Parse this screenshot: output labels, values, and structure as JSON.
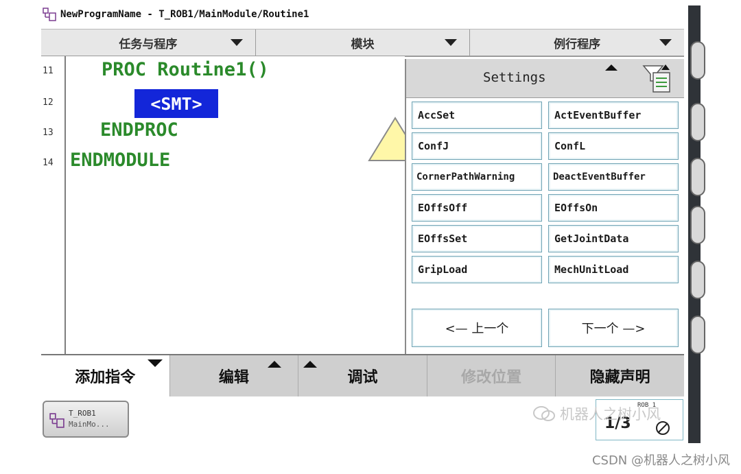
{
  "window": {
    "title": "NewProgramName - T_ROB1/MainModule/Routine1"
  },
  "top_tabs": [
    {
      "label": "任务与程序"
    },
    {
      "label": "模块"
    },
    {
      "label": "例行程序"
    }
  ],
  "editor": {
    "line_numbers": [
      "11",
      "12",
      "13",
      "14"
    ],
    "lines": [
      {
        "text": "PROC Routine1()"
      },
      {
        "text": "<SMT>"
      },
      {
        "text": "ENDPROC"
      },
      {
        "text": "ENDMODULE"
      }
    ]
  },
  "panel": {
    "title": "Settings",
    "instructions": [
      "AccSet",
      "ActEventBuffer",
      "ConfJ",
      "ConfL",
      "CornerPathWarning",
      "DeactEventBuffer",
      "EOffsOff",
      "EOffsOn",
      "EOffsSet",
      "GetJointData",
      "GripLoad",
      "MechUnitLoad"
    ],
    "prev_label": "<—  上一个",
    "next_label": "下一个 —>"
  },
  "bottom_menu": [
    {
      "label": "添加指令",
      "state": "active"
    },
    {
      "label": "编辑",
      "state": "normal"
    },
    {
      "label": "调试",
      "state": "normal"
    },
    {
      "label": "修改位置",
      "state": "disabled"
    },
    {
      "label": "隐藏声明",
      "state": "normal"
    }
  ],
  "taskbar": {
    "task_line1": "T_ROB1",
    "task_line2": "MainMo...",
    "quickset_tiny": "ROB_1",
    "quickset_fraction": "1/3"
  },
  "watermark": "机器人之树小风",
  "footer": "CSDN @机器人之树小风",
  "colors": {
    "code_green": "#2b8a2b",
    "selection_blue": "#1326d9",
    "button_border": "#6fa3b4"
  }
}
